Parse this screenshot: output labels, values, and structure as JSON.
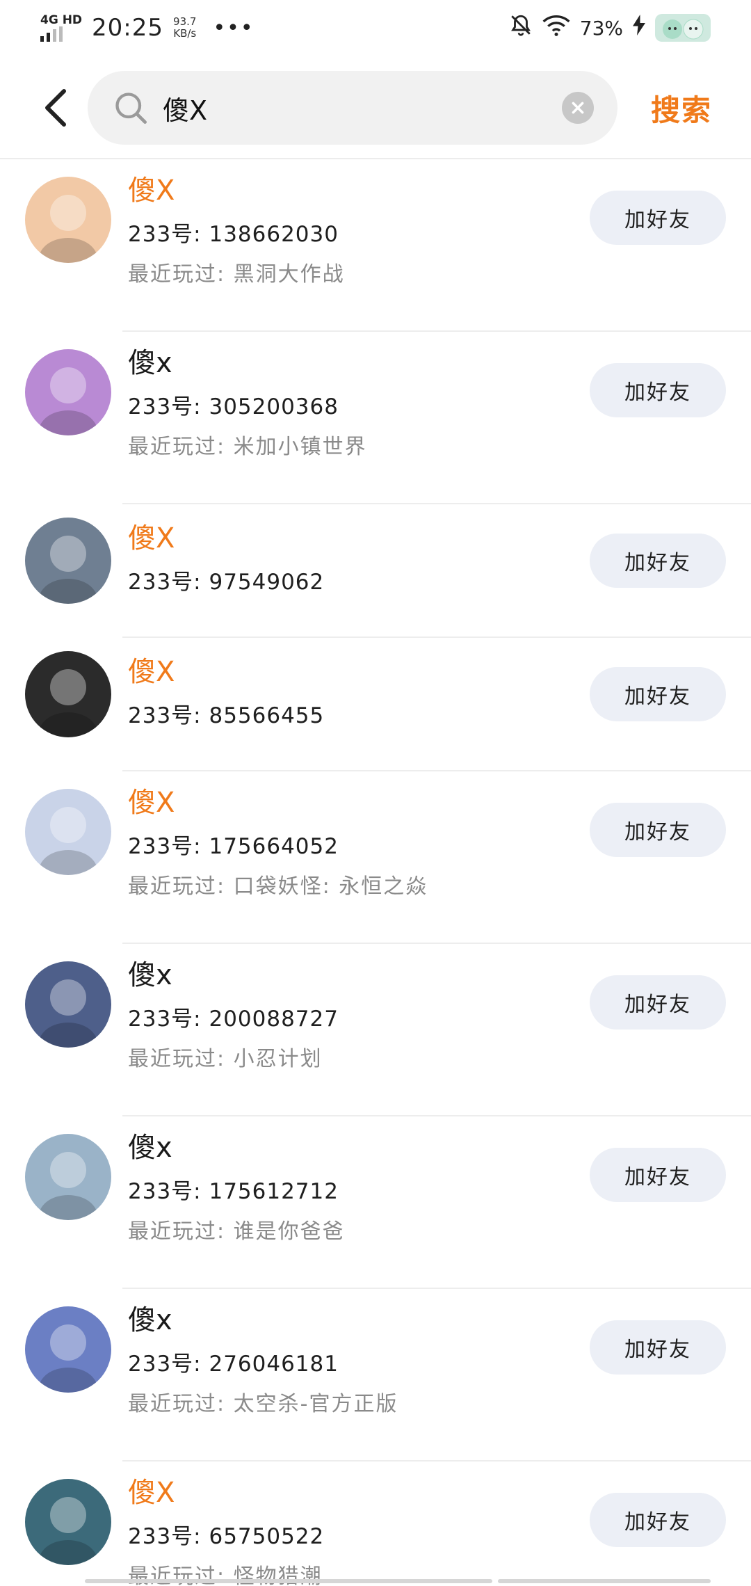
{
  "status_bar": {
    "network": "4G HD",
    "time": "20:25",
    "speed_value": "93.7",
    "speed_unit": "KB/s",
    "more": "•••",
    "battery": "73%"
  },
  "header": {
    "query": "傻X",
    "search_label": "搜索"
  },
  "results": [
    {
      "name": "傻X",
      "highlight": true,
      "uid": "233号: 138662030",
      "recent": "最近玩过: 黑洞大作战",
      "button": "加好友",
      "avatar_color": "#f2c9a6"
    },
    {
      "name": "傻x",
      "highlight": false,
      "uid": "233号: 305200368",
      "recent": "最近玩过: 米加小镇世界",
      "button": "加好友",
      "avatar_color": "#b98ad4"
    },
    {
      "name": "傻X",
      "highlight": true,
      "uid": "233号: 97549062",
      "recent": "",
      "button": "加好友",
      "avatar_color": "#6f7f92"
    },
    {
      "name": "傻X",
      "highlight": true,
      "uid": "233号: 85566455",
      "recent": "",
      "button": "加好友",
      "avatar_color": "#2b2b2b"
    },
    {
      "name": "傻X",
      "highlight": true,
      "uid": "233号: 175664052",
      "recent": "最近玩过: 口袋妖怪: 永恒之焱",
      "button": "加好友",
      "avatar_color": "#c9d3e8"
    },
    {
      "name": "傻x",
      "highlight": false,
      "uid": "233号: 200088727",
      "recent": "最近玩过: 小忍计划",
      "button": "加好友",
      "avatar_color": "#4e5f8a"
    },
    {
      "name": "傻x",
      "highlight": false,
      "uid": "233号: 175612712",
      "recent": "最近玩过: 谁是你爸爸",
      "button": "加好友",
      "avatar_color": "#9ab3c8"
    },
    {
      "name": "傻x",
      "highlight": false,
      "uid": "233号: 276046181",
      "recent": "最近玩过: 太空杀-官方正版",
      "button": "加好友",
      "avatar_color": "#6b7fc4"
    },
    {
      "name": "傻X",
      "highlight": true,
      "uid": "233号: 65750522",
      "recent": "最近玩过: 怪物猎潮",
      "button": "加好友",
      "avatar_color": "#3c6a7a"
    }
  ]
}
